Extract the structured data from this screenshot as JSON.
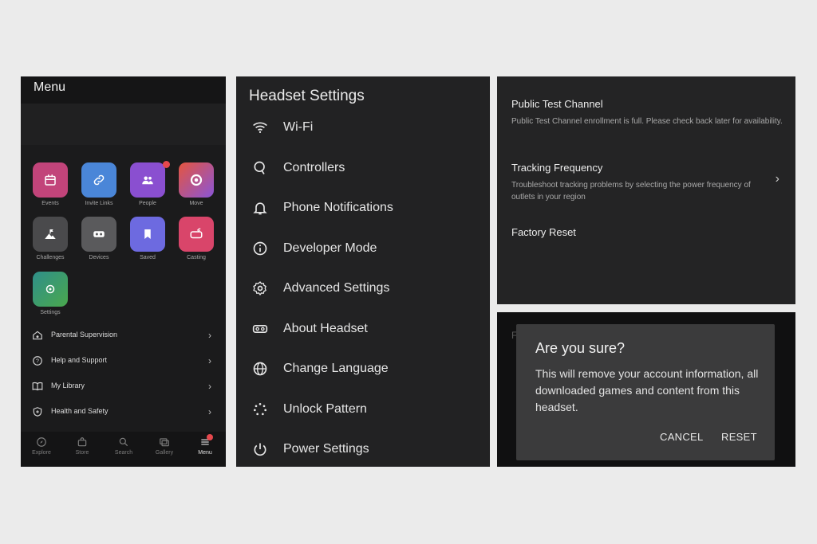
{
  "menu_panel": {
    "title": "Menu",
    "tiles": [
      {
        "label": "Events",
        "icon": "calendar-icon",
        "color": "#c2447a"
      },
      {
        "label": "Invite Links",
        "icon": "link-icon",
        "color": "#4a86d8"
      },
      {
        "label": "People",
        "icon": "people-icon",
        "color": "#8a4fd0",
        "badge": "1"
      },
      {
        "label": "Move",
        "icon": "ring-icon",
        "color": "#e4553f"
      },
      {
        "label": "Challenges",
        "icon": "mountain-flag-icon",
        "color": "#4a4a4c"
      },
      {
        "label": "Devices",
        "icon": "vr-headset-icon",
        "color": "#5a5a5c"
      },
      {
        "label": "Saved",
        "icon": "bookmark-icon",
        "color": "#6d6ae0"
      },
      {
        "label": "Casting",
        "icon": "cast-icon",
        "color": "#d9456a"
      },
      {
        "label": "Settings",
        "icon": "gear-icon",
        "color": "#3a9a66"
      }
    ],
    "rows": [
      {
        "label": "Parental Supervision",
        "icon": "home-shield-icon"
      },
      {
        "label": "Help and Support",
        "icon": "help-icon"
      },
      {
        "label": "My Library",
        "icon": "book-icon"
      },
      {
        "label": "Health and Safety",
        "icon": "shield-icon"
      }
    ],
    "nav": [
      {
        "label": "Explore",
        "icon": "compass-icon"
      },
      {
        "label": "Store",
        "icon": "store-icon"
      },
      {
        "label": "Search",
        "icon": "search-icon"
      },
      {
        "label": "Gallery",
        "icon": "gallery-icon"
      },
      {
        "label": "Menu",
        "icon": "menu-icon",
        "active": true
      }
    ]
  },
  "headset_settings": {
    "title": "Headset Settings",
    "items": [
      {
        "label": "Wi-Fi",
        "icon": "wifi-icon"
      },
      {
        "label": "Controllers",
        "icon": "controller-icon"
      },
      {
        "label": "Phone Notifications",
        "icon": "bell-icon"
      },
      {
        "label": "Developer Mode",
        "icon": "info-icon"
      },
      {
        "label": "Advanced Settings",
        "icon": "gear-icon"
      },
      {
        "label": "About Headset",
        "icon": "vr-headset-icon"
      },
      {
        "label": "Change Language",
        "icon": "globe-icon"
      },
      {
        "label": "Unlock Pattern",
        "icon": "dots-pattern-icon"
      },
      {
        "label": "Power Settings",
        "icon": "power-icon"
      }
    ]
  },
  "advanced_panel": {
    "ptc_title": "Public Test Channel",
    "ptc_desc": "Public Test Channel enrollment is full. Please check back later for availability.",
    "tracking_title": "Tracking Frequency",
    "tracking_desc": "Troubleshoot tracking problems by selecting the power frequency of outlets in your region",
    "factory_reset": "Factory Reset"
  },
  "dialog": {
    "background_text": "F",
    "title": "Are you sure?",
    "body": "This will remove your account information, all downloaded games and content from this headset.",
    "cancel": "CANCEL",
    "reset": "RESET"
  }
}
